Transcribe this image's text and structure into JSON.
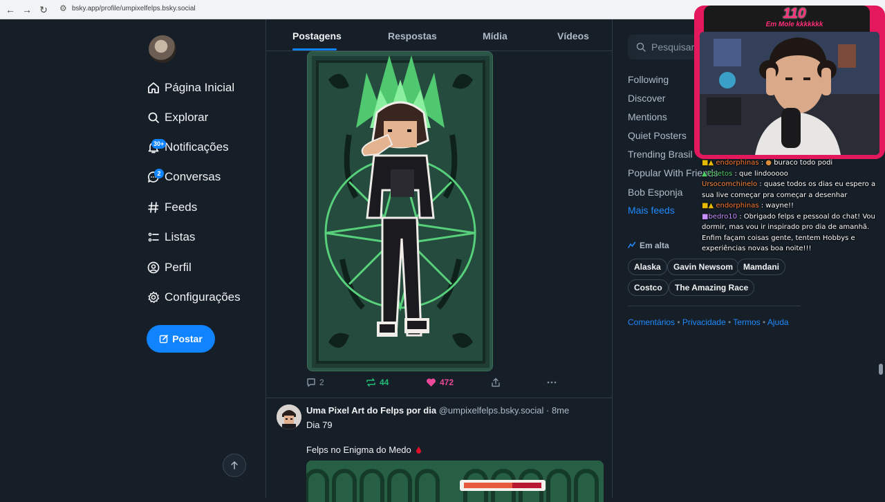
{
  "browser": {
    "url": "bsky.app/profile/umpixelfelps.bsky.social"
  },
  "nav": {
    "items": [
      {
        "label": "Página Inicial"
      },
      {
        "label": "Explorar"
      },
      {
        "label": "Notificações",
        "badge": "30+"
      },
      {
        "label": "Conversas",
        "badge": "2"
      },
      {
        "label": "Feeds"
      },
      {
        "label": "Listas"
      },
      {
        "label": "Perfil"
      },
      {
        "label": "Configurações"
      }
    ],
    "post_button": "Postar"
  },
  "tabs": [
    "Postagens",
    "Respostas",
    "Mídia",
    "Vídeos"
  ],
  "post1": {
    "replies": "2",
    "reposts": "44",
    "likes": "472"
  },
  "post2": {
    "author": "Uma Pixel Art do Felps por dia",
    "handle": "@umpixelfelps.bsky.social",
    "time": "· 8me",
    "line1": "Dia 79",
    "line2": "Felps no Enigma do Medo"
  },
  "search": {
    "placeholder": "Pesquisar"
  },
  "feeds": [
    "Following",
    "Discover",
    "Mentions",
    "Quiet Posters",
    "Trending Brasil",
    "Popular With Friends",
    "Bob Esponja"
  ],
  "more_feeds": "Mais feeds",
  "trending": {
    "title": "Em alta",
    "topics": [
      "Alaska",
      "Gavin Newsom",
      "Mamdani",
      "Costco",
      "The Amazing Race"
    ]
  },
  "footer": [
    "Comentários",
    "Privacidade",
    "Termos",
    "Ajuda"
  ],
  "overlay": {
    "count": "110",
    "subtitle": "Em Mole  kkkkkkk"
  },
  "chat": [
    {
      "user": "endorphinas",
      "color": "#ff7a2f",
      "text": "buraco todo podi"
    },
    {
      "user": "Ppietos",
      "color": "#4fd16a",
      "text": "que lindooooo"
    },
    {
      "user": "Ursocomchinelo",
      "color": "#ff8a3c",
      "text": "quase todos os dias eu espero a sua live começar pra começar a desenhar"
    },
    {
      "user": "endorphinas",
      "color": "#ff7a2f",
      "text": "wayne!!"
    },
    {
      "user": "bedro10",
      "color": "#c890ff",
      "text": "Obrigado felps e pessoal do chat! Vou dormir, mas vou ir inspirado pro dia de amanhã. Enfim façam coisas gente, tentem Hobbys e experiências novas boa noite!!!"
    }
  ],
  "colors": {
    "accent": "#1083fe",
    "like": "#ec4899",
    "repost": "#20bc73",
    "background": "#161e27"
  }
}
